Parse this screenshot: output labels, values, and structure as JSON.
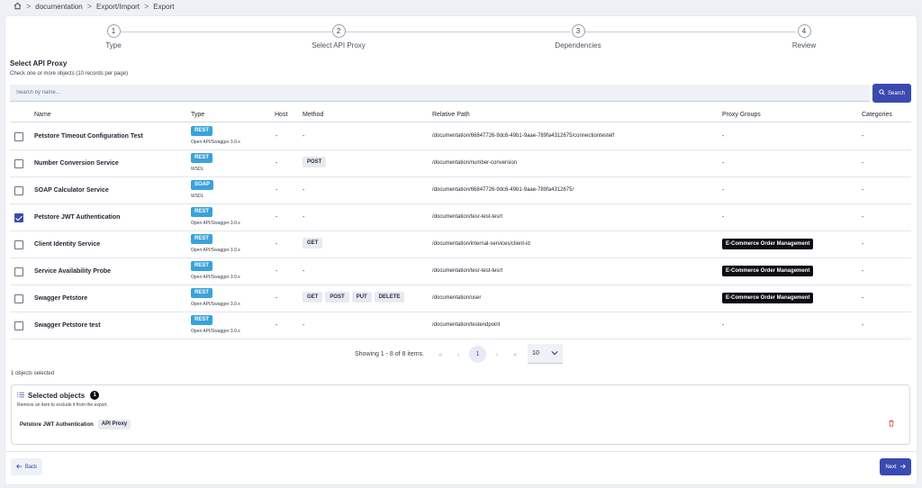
{
  "breadcrumb": {
    "home_icon": "home-icon",
    "items": [
      "documentation",
      "Export/Import",
      "Export"
    ],
    "separator": ">"
  },
  "stepper": {
    "steps": [
      {
        "number": "1",
        "label": "Type"
      },
      {
        "number": "2",
        "label": "Select API Proxy"
      },
      {
        "number": "3",
        "label": "Dependencies"
      },
      {
        "number": "4",
        "label": "Review"
      }
    ],
    "active_step": 2
  },
  "section": {
    "title": "Select API Proxy",
    "subtitle": "Check one or more objects (10 records per page)"
  },
  "search": {
    "placeholder": "Search by name...",
    "value": "",
    "button_label": "Search",
    "button_icon": "search-icon"
  },
  "table": {
    "headers": [
      "Name",
      "Type",
      "Host",
      "Method",
      "Relative Path",
      "Proxy Groups",
      "Categories"
    ],
    "rows": [
      {
        "checked": false,
        "name": "Petstore Timeout Configuration Test",
        "type": "REST",
        "type_sub": "Open API/Swagger 3.0.x",
        "host": "-",
        "methods": [],
        "method_dash": "-",
        "path": "/documentation/66847726-9dc6-49b1-9aae-789fa4312675/connectiontestelf",
        "group": "",
        "group_dash": "-",
        "category": "-"
      },
      {
        "checked": false,
        "name": "Number Conversion Service",
        "type": "REST",
        "type_sub": "WSDL",
        "host": "-",
        "methods": [
          "POST"
        ],
        "method_dash": "",
        "path": "/documentation/number-conversion",
        "group": "",
        "group_dash": "-",
        "category": "-"
      },
      {
        "checked": false,
        "name": "SOAP Calculator Service",
        "type": "SOAP",
        "type_sub": "WSDL",
        "host": "-",
        "methods": [],
        "method_dash": "-",
        "path": "/documentation/66847726-9dc6-49b1-9aae-789fa4312675/",
        "group": "",
        "group_dash": "-",
        "category": "-"
      },
      {
        "checked": true,
        "name": "Petstore JWT Authentication",
        "type": "REST",
        "type_sub": "Open API/Swagger 3.0.x",
        "host": "-",
        "methods": [],
        "method_dash": "-",
        "path": "/documentation/tesr-test-tesrt",
        "group": "",
        "group_dash": "-",
        "category": "-"
      },
      {
        "checked": false,
        "name": "Client Identity Service",
        "type": "REST",
        "type_sub": "Open API/Swagger 3.0.x",
        "host": "-",
        "methods": [
          "GET"
        ],
        "method_dash": "",
        "path": "/documentation/internal-services/client-id",
        "group": "E-Commerce Order Management",
        "group_dash": "",
        "category": "-"
      },
      {
        "checked": false,
        "name": "Service Availability Probe",
        "type": "REST",
        "type_sub": "Open API/Swagger 3.0.x",
        "host": "-",
        "methods": [],
        "method_dash": "-",
        "path": "/documentation/tesr-test-tesrt",
        "group": "E-Commerce Order Management",
        "group_dash": "",
        "category": "-"
      },
      {
        "checked": false,
        "name": "Swagger Petstore",
        "type": "REST",
        "type_sub": "Open API/Swagger 3.0.x",
        "host": "-",
        "methods": [
          "GET",
          "POST",
          "PUT",
          "DELETE"
        ],
        "method_dash": "",
        "path": "/documentation/user",
        "group": "E-Commerce Order Management",
        "group_dash": "",
        "category": "-"
      },
      {
        "checked": false,
        "name": "Swagger Petstore test",
        "type": "REST",
        "type_sub": "Open API/Swagger 3.0.x",
        "host": "-",
        "methods": [],
        "method_dash": "-",
        "path": "/documentation/testendpoint",
        "group": "",
        "group_dash": "-",
        "category": "-"
      }
    ]
  },
  "pagination": {
    "info": "Showing 1 - 8 of 8 items.",
    "current_page": "1",
    "page_size": "10",
    "first_icon": "«",
    "prev_icon": "‹",
    "next_icon": "›",
    "last_icon": "»"
  },
  "selection": {
    "count_text": "1 objects selected",
    "title": "Selected objects",
    "badge": "1",
    "subtitle": "Remove an item to exclude it from the export.",
    "items": [
      {
        "name": "Petstore JWT Authentication",
        "tag": "API Proxy"
      }
    ]
  },
  "footer": {
    "back_label": "Back",
    "next_label": "Next"
  },
  "colors": {
    "primary": "#3a4ab0",
    "rest_badge": "#3aa2db",
    "group_badge": "#0b0d12",
    "danger": "#e0453a"
  }
}
